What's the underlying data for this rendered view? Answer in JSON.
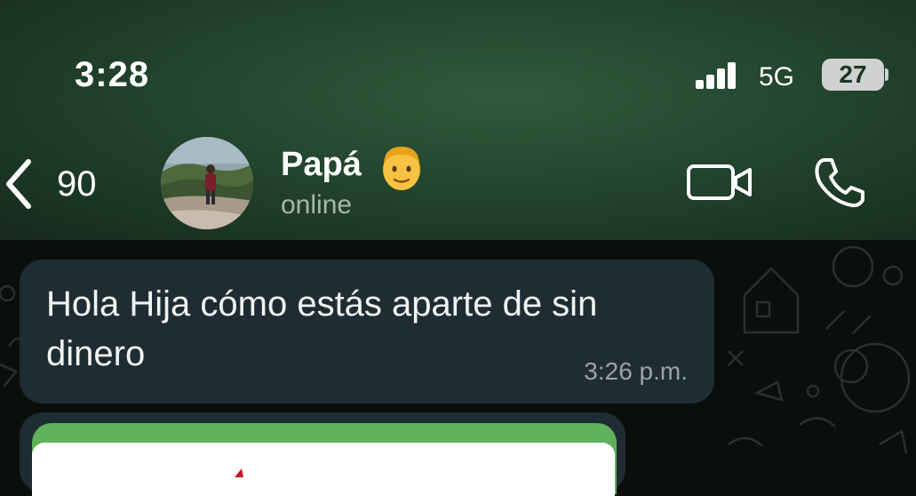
{
  "status_bar": {
    "time": "3:28",
    "network": "5G",
    "battery": "27"
  },
  "header": {
    "back_count": "90",
    "contact_name": "Papá",
    "contact_emoji": "man-face-emoji",
    "contact_status": "online",
    "video_icon": "video-camera-icon",
    "phone_icon": "phone-icon"
  },
  "messages": [
    {
      "text": "Hola Hija cómo estás aparte de sin dinero",
      "time": "3:26 p.m."
    }
  ],
  "colors": {
    "header_bg": "#23452e",
    "bubble_bg": "#202c33",
    "chat_bg": "#0b0f0c",
    "card_accent": "#5fb25a"
  }
}
